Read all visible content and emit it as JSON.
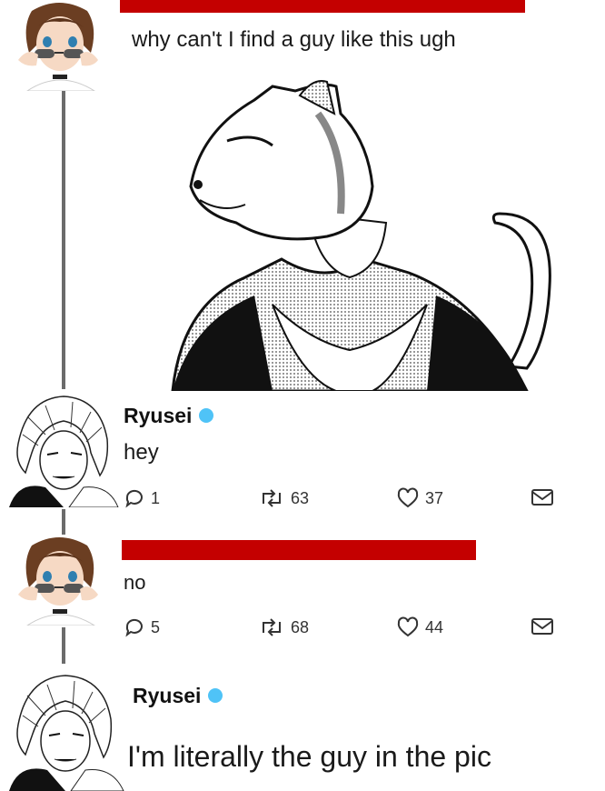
{
  "posts": [
    {
      "text": "why can't I find a guy like this ugh"
    },
    {
      "name": "Ryusei",
      "text": "hey",
      "replies": "1",
      "reposts": "63",
      "likes": "37"
    },
    {
      "text": "no",
      "replies": "5",
      "reposts": "68",
      "likes": "44"
    },
    {
      "name": "Ryusei",
      "text": "I'm literally the guy in the pic"
    }
  ],
  "colors": {
    "redaction": "#c40000",
    "verified": "#4fc3f7"
  }
}
